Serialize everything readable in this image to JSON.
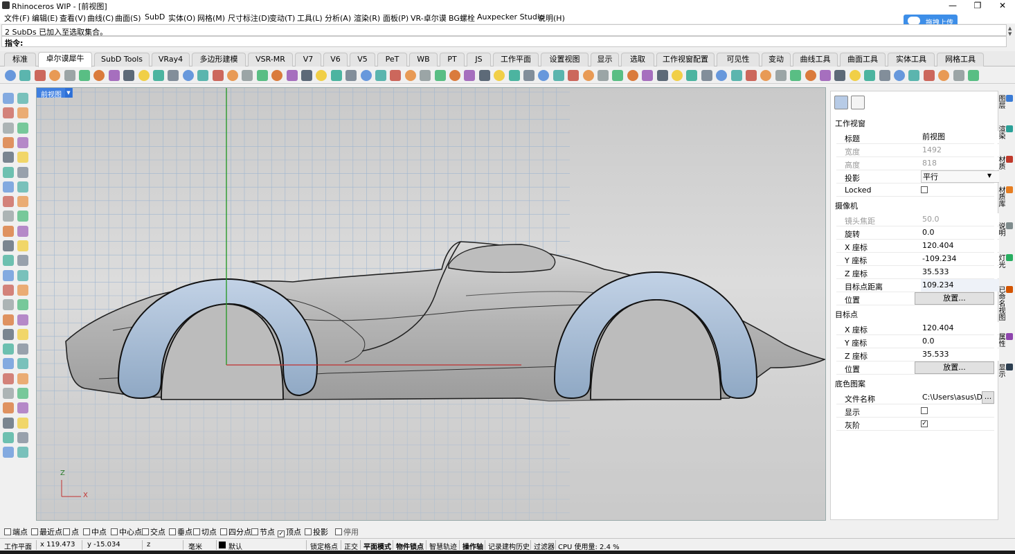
{
  "window": {
    "title": "Rhinoceros WIP - [前视图]"
  },
  "upload_button": "拖拽上传",
  "menu": [
    "文件(F)",
    "编辑(E)",
    "查看(V)",
    "曲线(C)",
    "曲面(S)",
    "SubD",
    "实体(O)",
    "网格(M)",
    "尺寸标注(D)",
    "变动(T)",
    "工具(L)",
    "分析(A)",
    "渲染(R)",
    "面板(P)",
    "VR-卓尔谟",
    "BG螺栓",
    "Auxpecker Studio",
    "说明(H)"
  ],
  "command": {
    "history": "2 SubDs 已加入至选取集合。",
    "prompt": "指令:"
  },
  "tabs": [
    "标准",
    "卓尔谟犀牛",
    "SubD Tools",
    "VRay4",
    "多边形建模",
    "VSR-MR",
    "V7",
    "V6",
    "V5",
    "PeT",
    "WB",
    "PT",
    "JS",
    "工作平面",
    "设置视图",
    "显示",
    "选取",
    "工作视窗配置",
    "可见性",
    "变动",
    "曲线工具",
    "曲面工具",
    "实体工具",
    "网格工具"
  ],
  "active_tab": "卓尔谟犀牛",
  "viewport": {
    "label": "前视图",
    "axis_z": "Z",
    "axis_x": "X"
  },
  "panel": {
    "section_viewport": "工作视窗",
    "title_label": "标题",
    "title_value": "前视图",
    "width_label": "宽度",
    "width_value": "1492",
    "height_label": "高度",
    "height_value": "818",
    "projection_label": "投影",
    "projection_value": "平行",
    "locked_label": "Locked",
    "section_camera": "摄像机",
    "lens_label": "镜头焦距",
    "lens_value": "50.0",
    "rotate_label": "旋转",
    "rotate_value": "0.0",
    "cx_label": "X 座标",
    "cx_value": "120.404",
    "cy_label": "Y 座标",
    "cy_value": "-109.234",
    "cz_label": "Z 座标",
    "cz_value": "35.533",
    "dist_label": "目标点距离",
    "dist_value": "109.234",
    "pos_label": "位置",
    "place_button": "放置...",
    "section_target": "目标点",
    "tx_label": "X 座标",
    "tx_value": "120.404",
    "ty_label": "Y 座标",
    "ty_value": "0.0",
    "tz_label": "Z 座标",
    "tz_value": "35.533",
    "tpos_label": "位置",
    "tplace_button": "放置...",
    "section_bg": "底色图案",
    "file_label": "文件名称",
    "file_value": "C:\\Users\\asus\\Des...",
    "file_browse": "...",
    "show_label": "显示",
    "gray_label": "灰阶"
  },
  "side_tabs": [
    "图层",
    "渲染",
    "材质",
    "材质库",
    "说明",
    "灯光",
    "已命名视图",
    "属性",
    "显示"
  ],
  "osnaps": [
    {
      "label": "端点",
      "checked": false
    },
    {
      "label": "最近点",
      "checked": false
    },
    {
      "label": "点",
      "checked": false
    },
    {
      "label": "中点",
      "checked": false
    },
    {
      "label": "中心点",
      "checked": false
    },
    {
      "label": "交点",
      "checked": false
    },
    {
      "label": "垂点",
      "checked": false
    },
    {
      "label": "切点",
      "checked": false
    },
    {
      "label": "四分点",
      "checked": false
    },
    {
      "label": "节点",
      "checked": false
    },
    {
      "label": "顶点",
      "checked": true
    },
    {
      "label": "投影",
      "checked": false
    },
    {
      "label": "停用",
      "checked": false
    }
  ],
  "status": {
    "cplane": "工作平面",
    "x": "x 119.473",
    "y": "y -15.034",
    "z": "z",
    "units": "毫米",
    "layer": "默认",
    "grid_snap": "锁定格点",
    "ortho": "正交",
    "planar": "平面模式",
    "osnap": "物件锁点",
    "smarttrack": "智慧轨迹",
    "gumball": "操作轴",
    "history": "记录建构历史",
    "filter": "过滤器",
    "cpu": "CPU 使用量: 2.4 %"
  },
  "colors": {
    "accent": "#3f7fe0",
    "wheel_arch": "#a9bdd6",
    "body": "#b9b9b9"
  }
}
